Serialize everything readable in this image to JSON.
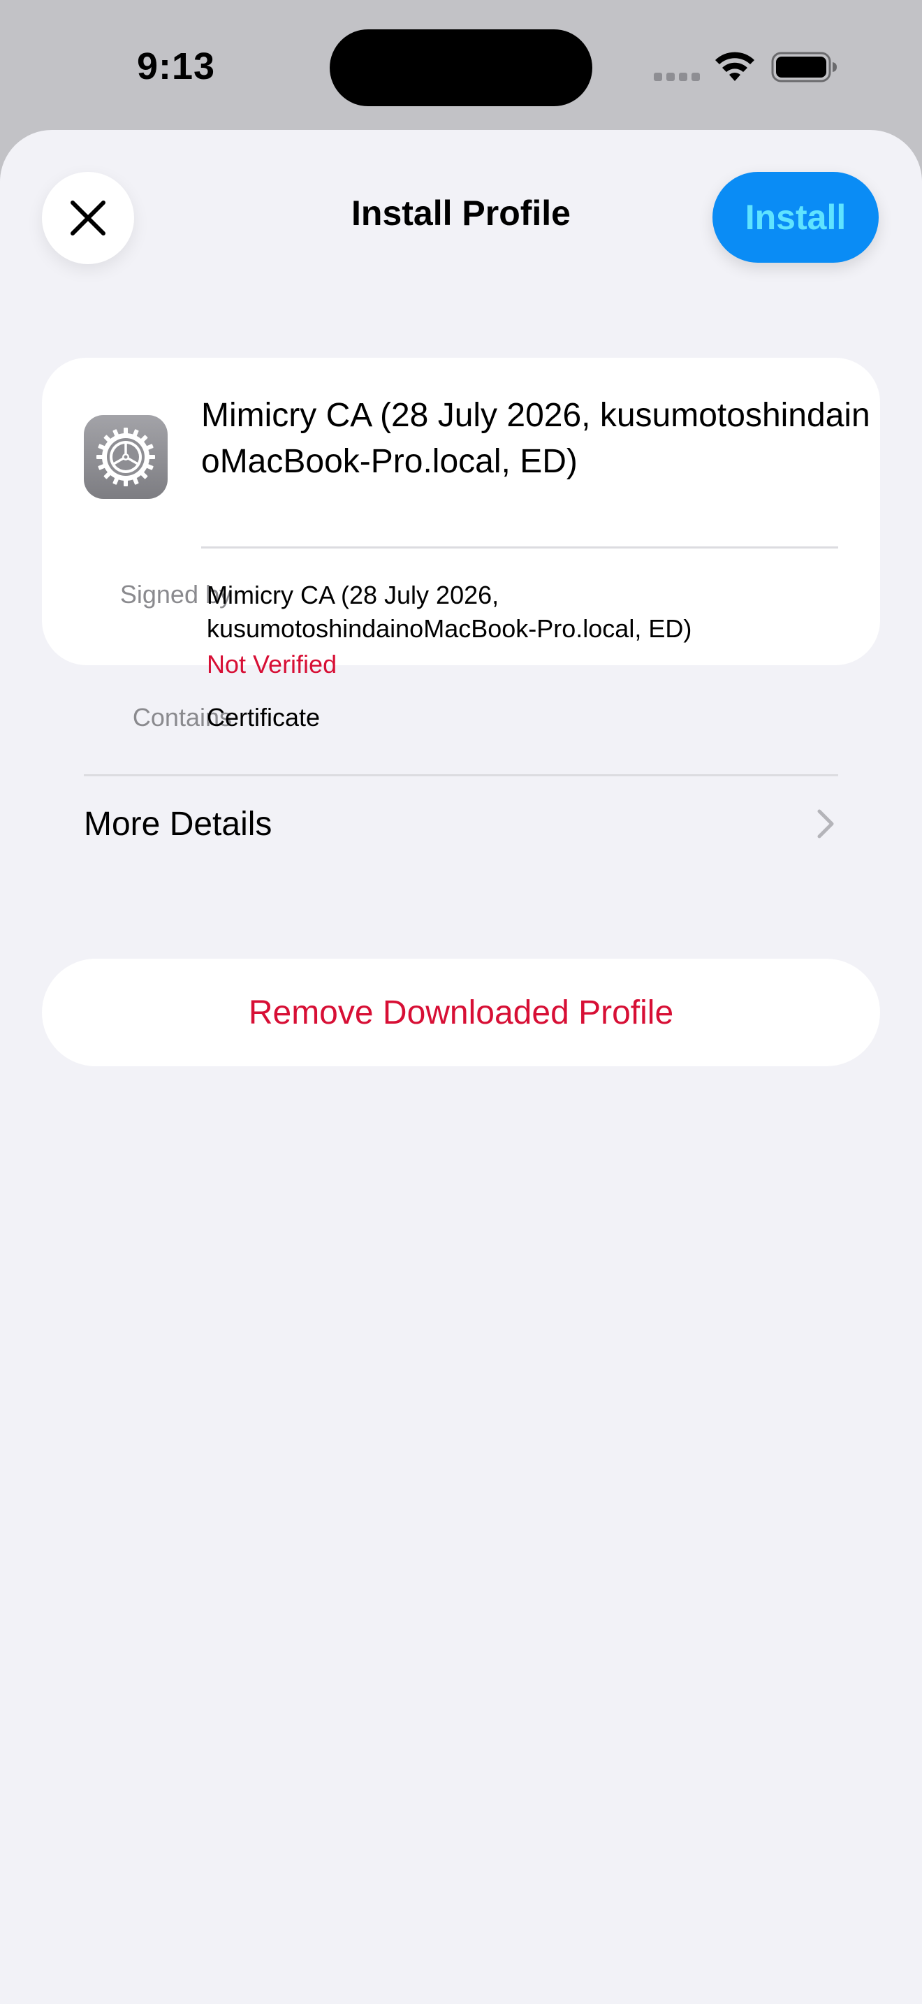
{
  "status_bar": {
    "time": "9:13"
  },
  "sheet": {
    "title": "Install Profile",
    "install_label": "Install"
  },
  "profile": {
    "name": "Mimicry CA (28 July 2026, kusumotoshindainoMacBook-Pro.local, ED)",
    "signed_by_label": "Signed by",
    "signed_by_value": "Mimicry CA (28 July 2026, kusumotoshindainoMacBook-Pro.local, ED)",
    "verification_status": "Not Verified",
    "contains_label": "Contains",
    "contains_value": "Certificate",
    "more_details_label": "More Details"
  },
  "remove_label": "Remove Downloaded Profile",
  "icons": {
    "close": "close-icon",
    "profile": "gear-icon",
    "more_details": "chevron-right-icon",
    "wifi": "wifi-icon",
    "battery": "battery-icon"
  },
  "colors": {
    "accent_blue": "#0a8cf5",
    "install_text": "#5fe3ff",
    "destructive_red": "#d70f35",
    "sheet_background": "#f2f2f7",
    "secondary_label": "#8a8a8e"
  }
}
